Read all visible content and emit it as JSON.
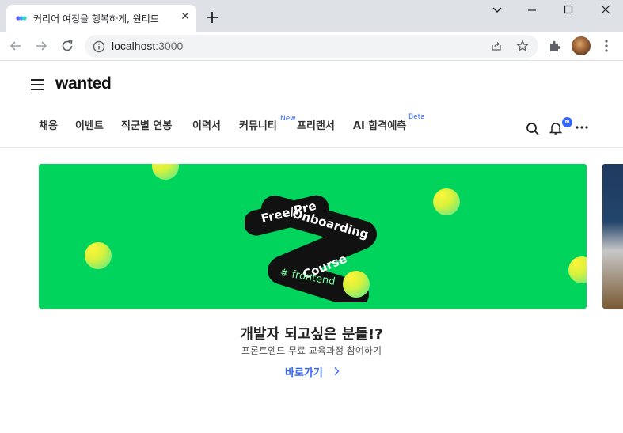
{
  "browser": {
    "tab_title": "커리어 여정을 행복하게, 원티드",
    "tab_close": "✕",
    "url_host": "localhost",
    "url_port": ":3000"
  },
  "header": {
    "logo": "wanted",
    "nav": [
      {
        "label": "채용"
      },
      {
        "label": "이벤트"
      },
      {
        "label": "직군별 연봉"
      },
      {
        "label": "이력서"
      },
      {
        "label": "커뮤니티",
        "badge": "New"
      },
      {
        "label": "프리랜서"
      },
      {
        "label": "AI 합격예측",
        "badge": "Beta"
      }
    ],
    "notification_badge": "N"
  },
  "banner": {
    "art_lines": [
      "Free/Pre",
      "Onboarding",
      "Course",
      "# frontend"
    ],
    "title": "개발자 되고싶은 분들!?",
    "subtitle": "프론트엔드 무료 교육과정 참여하기",
    "link_label": "바로가기",
    "colors": {
      "background": "#00d45c",
      "link": "#3366ff"
    }
  }
}
